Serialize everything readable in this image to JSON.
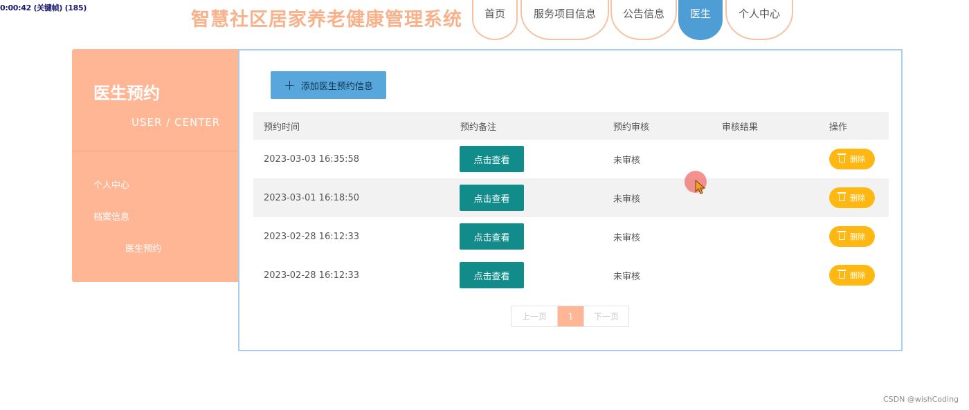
{
  "overlay": {
    "text": "0:00:42 (关键帧) (185)"
  },
  "header": {
    "title": "智慧社区居家养老健康管理系统",
    "nav": [
      {
        "label": "首页",
        "active": false
      },
      {
        "label": "服务项目信息",
        "active": false
      },
      {
        "label": "公告信息",
        "active": false
      },
      {
        "label": "医生",
        "active": true
      },
      {
        "label": "个人中心",
        "active": false
      }
    ]
  },
  "sidebar": {
    "title": "医生预约",
    "subtitle": "USER / CENTER",
    "items": [
      {
        "label": "个人中心"
      },
      {
        "label": "档案信息"
      },
      {
        "label": "医生预约"
      }
    ]
  },
  "main": {
    "add_button": {
      "icon": "plus-icon",
      "label": "添加医生预约信息"
    },
    "table": {
      "columns": [
        "预约时间",
        "预约备注",
        "预约审核",
        "审核结果",
        "操作"
      ],
      "rows": [
        {
          "time": "2023-03-03 16:35:58",
          "view_label": "点击查看",
          "review": "未审核",
          "result": "",
          "delete_label": "删除"
        },
        {
          "time": "2023-03-01 16:18:50",
          "view_label": "点击查看",
          "review": "未审核",
          "result": "",
          "delete_label": "删除"
        },
        {
          "time": "2023-02-28 16:12:33",
          "view_label": "点击查看",
          "review": "未审核",
          "result": "",
          "delete_label": "删除"
        },
        {
          "time": "2023-02-28 16:12:33",
          "view_label": "点击查看",
          "review": "未审核",
          "result": "",
          "delete_label": "删除"
        }
      ]
    },
    "pagination": {
      "prev": "上一页",
      "current": "1",
      "next": "下一页"
    }
  },
  "watermark": "CSDN @wishCoding",
  "colors": {
    "accent_peach": "#ffb694",
    "title_peach": "#f7b18b",
    "active_blue": "#4e9dd4",
    "add_button_blue": "#57a7dc",
    "view_button_teal": "#128b8b",
    "delete_button_yellow": "#ffb811"
  }
}
